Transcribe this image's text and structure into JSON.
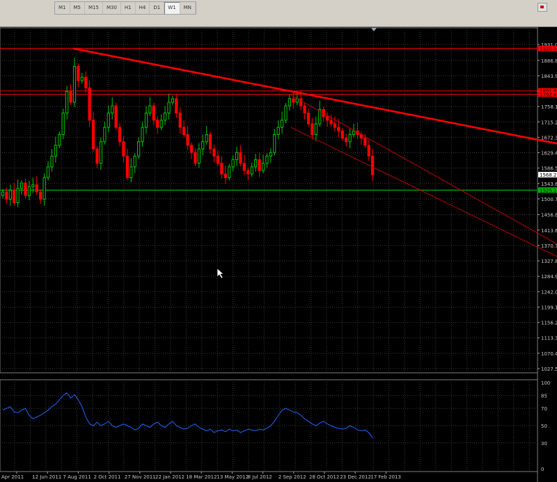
{
  "toolbar": {
    "timeframes": [
      {
        "label": "M1",
        "active": false
      },
      {
        "label": "M5",
        "active": false
      },
      {
        "label": "M15",
        "active": false
      },
      {
        "label": "M30",
        "active": false
      },
      {
        "label": "H1",
        "active": false
      },
      {
        "label": "H4",
        "active": false
      },
      {
        "label": "D1",
        "active": false
      },
      {
        "label": "W1",
        "active": true
      },
      {
        "label": "MN",
        "active": false
      }
    ]
  },
  "colors": {
    "background": "#000000",
    "grid": "#3c3c3c",
    "bull": "#00c800",
    "bear": "#ff0000",
    "trendline": "#ff0000",
    "support": "#00b000",
    "indicator": "#1e64ff"
  },
  "chart_data": {
    "type": "candlestick",
    "timeframe": "W1",
    "price_ticks": [
      "1931.00",
      "1886.80",
      "1843.90",
      "1801.00",
      "1758.10",
      "1715.20",
      "1672.30",
      "1629.40",
      "1586.50",
      "1543.60",
      "1500.70",
      "1456.80",
      "1413.60",
      "1370.70",
      "1327.80",
      "1284.90",
      "1242.00",
      "1199.10",
      "1156.20",
      "1113.30",
      "1070.40",
      "1027.50"
    ],
    "date_labels": [
      "Apr 2011",
      "12 Jun 2011",
      "7 Aug 2011",
      "2 Oct 2011",
      "27 Nov 2011",
      "22 Jan 2012",
      "18 Mar 2012",
      "13 May 2012",
      "8 Jul 2012",
      "2 Sep 2012",
      "28 Oct 2012",
      "23 Dec 2012",
      "17 Feb 2013"
    ],
    "price_tags": [
      {
        "text": "1920.00",
        "price": 1920,
        "color": "#ff0000"
      },
      {
        "text": "1801.60",
        "price": 1801.6,
        "color": "#ff0000"
      },
      {
        "text": "1792.40",
        "price": 1792.4,
        "color": "#ff0000"
      },
      {
        "text": "1568.20",
        "price": 1568.2,
        "color": "#ffffff"
      },
      {
        "text": "1525.10",
        "price": 1525.1,
        "color": "#00b000"
      }
    ],
    "closes": [
      1520,
      1500,
      1525,
      1490,
      1530,
      1545,
      1510,
      1535,
      1540,
      1520,
      1500,
      1560,
      1590,
      1620,
      1650,
      1680,
      1740,
      1800,
      1770,
      1870,
      1830,
      1840,
      1810,
      1720,
      1640,
      1600,
      1660,
      1700,
      1740,
      1760,
      1700,
      1660,
      1620,
      1560,
      1590,
      1620,
      1660,
      1700,
      1740,
      1760,
      1720,
      1700,
      1720,
      1740,
      1770,
      1780,
      1740,
      1700,
      1680,
      1650,
      1630,
      1600,
      1640,
      1660,
      1680,
      1640,
      1620,
      1600,
      1570,
      1560,
      1590,
      1610,
      1630,
      1600,
      1580,
      1570,
      1590,
      1610,
      1580,
      1600,
      1620,
      1630,
      1680,
      1700,
      1720,
      1760,
      1780,
      1770,
      1780,
      1760,
      1740,
      1710,
      1680,
      1710,
      1750,
      1730,
      1720,
      1710,
      1700,
      1690,
      1670,
      1660,
      1680,
      1690,
      1680,
      1670,
      1650,
      1620,
      1568
    ],
    "indicator": {
      "levels": [
        "100",
        "85",
        "70",
        "50",
        "30",
        "0"
      ],
      "values": [
        68,
        70,
        72,
        66,
        65,
        68,
        70,
        62,
        58,
        60,
        62,
        65,
        68,
        72,
        75,
        80,
        85,
        88,
        82,
        86,
        80,
        72,
        60,
        52,
        50,
        54,
        50,
        52,
        55,
        50,
        48,
        50,
        52,
        50,
        48,
        45,
        47,
        52,
        50,
        48,
        52,
        54,
        50,
        48,
        52,
        55,
        50,
        48,
        46,
        47,
        50,
        52,
        48,
        46,
        44,
        46,
        42,
        44,
        45,
        43,
        46,
        44,
        45,
        42,
        44,
        46,
        45,
        44,
        46,
        45,
        47,
        50,
        55,
        62,
        68,
        70,
        68,
        66,
        65,
        62,
        58,
        55,
        52,
        50,
        53,
        55,
        52,
        50,
        48,
        47,
        46,
        47,
        50,
        48,
        45,
        44,
        45,
        42,
        36
      ]
    }
  }
}
